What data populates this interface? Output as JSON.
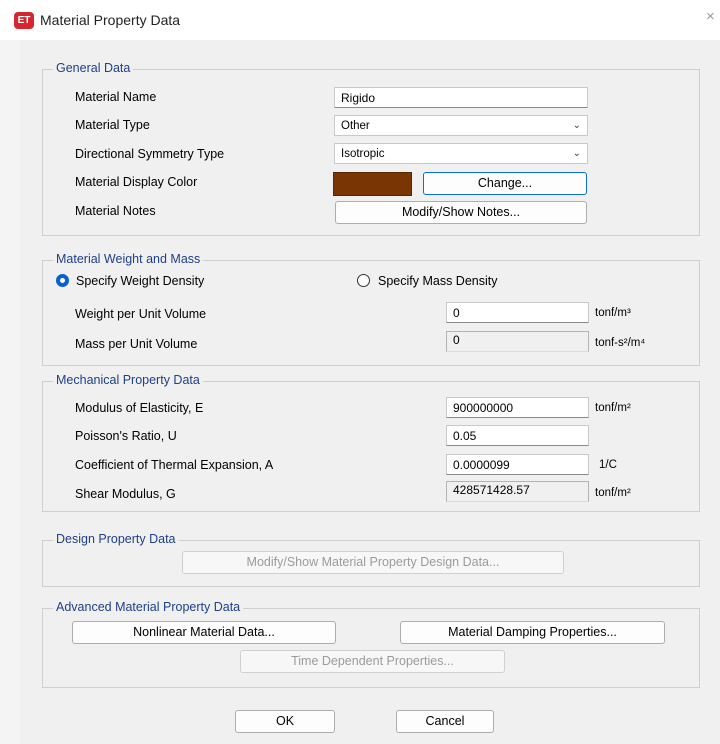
{
  "window": {
    "title": "Material Property Data",
    "app_icon_text": "ET",
    "close_glyph": "×"
  },
  "general": {
    "title": "General Data",
    "name_label": "Material Name",
    "name_value": "Rigido",
    "type_label": "Material Type",
    "type_value": "Other",
    "symmetry_label": "Directional Symmetry Type",
    "symmetry_value": "Isotropic",
    "color_label": "Material Display Color",
    "color_value": "#7a3504",
    "change_button": "Change...",
    "notes_label": "Material Notes",
    "notes_button": "Modify/Show Notes..."
  },
  "weight": {
    "title": "Material Weight and Mass",
    "radio_weight": "Specify Weight Density",
    "radio_mass": "Specify Mass Density",
    "selected": "weight",
    "weight_label": "Weight per Unit Volume",
    "weight_value": "0",
    "weight_unit": "tonf/m³",
    "mass_label": "Mass per Unit Volume",
    "mass_value": "0",
    "mass_unit": "tonf-s²/m⁴"
  },
  "mechanical": {
    "title": "Mechanical Property Data",
    "e_label": "Modulus of Elasticity,  E",
    "e_value": "900000000",
    "e_unit": "tonf/m²",
    "u_label": "Poisson's Ratio,  U",
    "u_value": "0.05",
    "a_label": "Coefficient of Thermal Expansion,  A",
    "a_value": "0.0000099",
    "a_unit": "1/C",
    "g_label": "Shear Modulus,  G",
    "g_value": "428571428.57",
    "g_unit": "tonf/m²"
  },
  "design": {
    "title": "Design Property Data",
    "button": "Modify/Show Material Property Design Data..."
  },
  "advanced": {
    "title": "Advanced Material Property Data",
    "nonlinear_button": "Nonlinear Material Data...",
    "damping_button": "Material Damping Properties...",
    "time_button": "Time Dependent Properties..."
  },
  "footer": {
    "ok": "OK",
    "cancel": "Cancel"
  }
}
